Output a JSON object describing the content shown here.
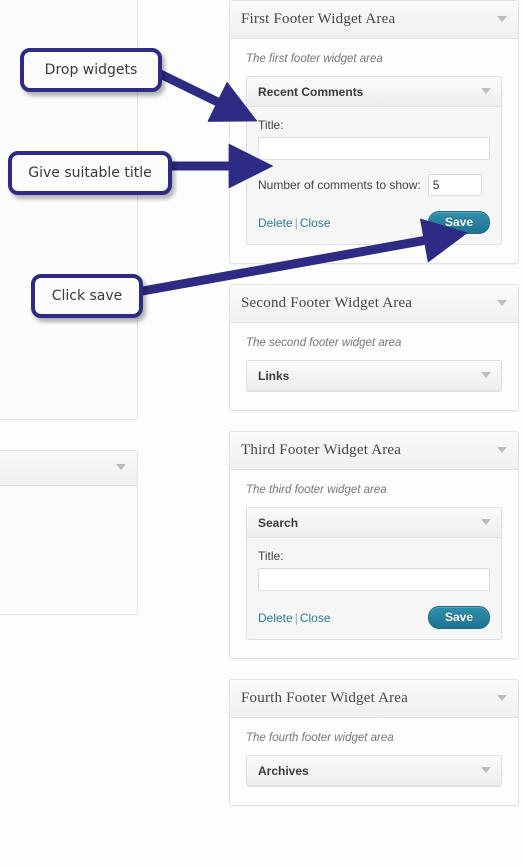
{
  "annotations": [
    {
      "id": "drop-widgets",
      "label": "Drop widgets"
    },
    {
      "id": "give-title",
      "label": "Give suitable title"
    },
    {
      "id": "click-save",
      "label": "Click save"
    }
  ],
  "colors": {
    "annotation_border": "#2e2b84",
    "annotation_arrow": "#2e2b84",
    "save_button": "#2478a0",
    "link": "#2b7b94",
    "panel_border": "#e3e3e3",
    "header_text": "#464646"
  },
  "widget_areas": [
    {
      "title": "First Footer Widget Area",
      "description": "The first footer widget area",
      "toggle_icon": "chevron-down-icon",
      "widget": {
        "name": "Recent Comments",
        "expanded": true,
        "toggle_icon": "chevron-down-icon",
        "fields": {
          "title_label": "Title:",
          "title_value": "",
          "title_placeholder": "",
          "count_label": "Number of comments to show:",
          "count_value": "5"
        },
        "footer": {
          "delete_label": "Delete",
          "separator": "|",
          "close_label": "Close",
          "save_label": "Save"
        }
      }
    },
    {
      "title": "Second Footer Widget Area",
      "description": "The second footer widget area",
      "toggle_icon": "chevron-down-icon",
      "widget": {
        "name": "Links",
        "expanded": false,
        "toggle_icon": "chevron-down-icon"
      }
    },
    {
      "title": "Third Footer Widget Area",
      "description": "The third footer widget area",
      "toggle_icon": "chevron-down-icon",
      "widget": {
        "name": "Search",
        "expanded": true,
        "toggle_icon": "chevron-down-icon",
        "fields": {
          "title_label": "Title:",
          "title_value": "",
          "title_placeholder": ""
        },
        "footer": {
          "delete_label": "Delete",
          "separator": "|",
          "close_label": "Close",
          "save_label": "Save"
        }
      }
    },
    {
      "title": "Fourth Footer Widget Area",
      "description": "The fourth footer widget area",
      "toggle_icon": "chevron-down-icon",
      "widget": {
        "name": "Archives",
        "expanded": false,
        "toggle_icon": "chevron-down-icon"
      }
    }
  ],
  "left_column": {
    "panels": [
      {
        "id": "left-panel-upper",
        "toggle_icon": null
      },
      {
        "id": "left-panel-lower",
        "toggle_icon": "chevron-down-icon"
      }
    ]
  }
}
